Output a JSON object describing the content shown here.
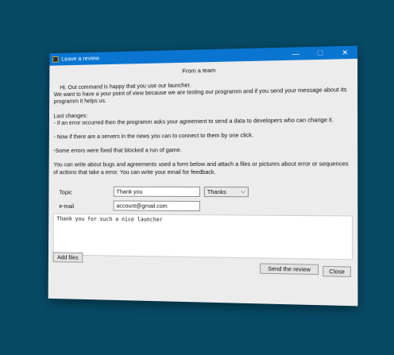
{
  "window": {
    "title": "Leave a review",
    "min_glyph": "—",
    "max_glyph": "☐",
    "close_glyph": "✕"
  },
  "header": "From a team",
  "message": {
    "lines": [
      "    Hi. Out command is happy that you use our launcher.",
      "We want to have a your point of view because we are testing our programm and if you send your message about its programm it helps us.",
      "Last changes:",
      "- If an error occurred then the programm asks your agreement to send a data to developers who can change it.",
      "- Now if there are a servers in the news you can to connect to them by one click.",
      "-Some errors were fixed that blocked a run of game.",
      "You can write about bugs and agreements used a form below and attach a files or pictures about error or sequences of actions that take a error. You can write your email for feedback."
    ]
  },
  "form": {
    "topic_label": "Topic",
    "topic_value": "Thank you",
    "topic_select": "Thanks",
    "email_label": "e-mail",
    "email_value": "account@gmail.com",
    "message_value": "Thank you for such a nice launcher"
  },
  "buttons": {
    "add_files": "Add files",
    "send_review": "Send the review",
    "close": "Close"
  }
}
